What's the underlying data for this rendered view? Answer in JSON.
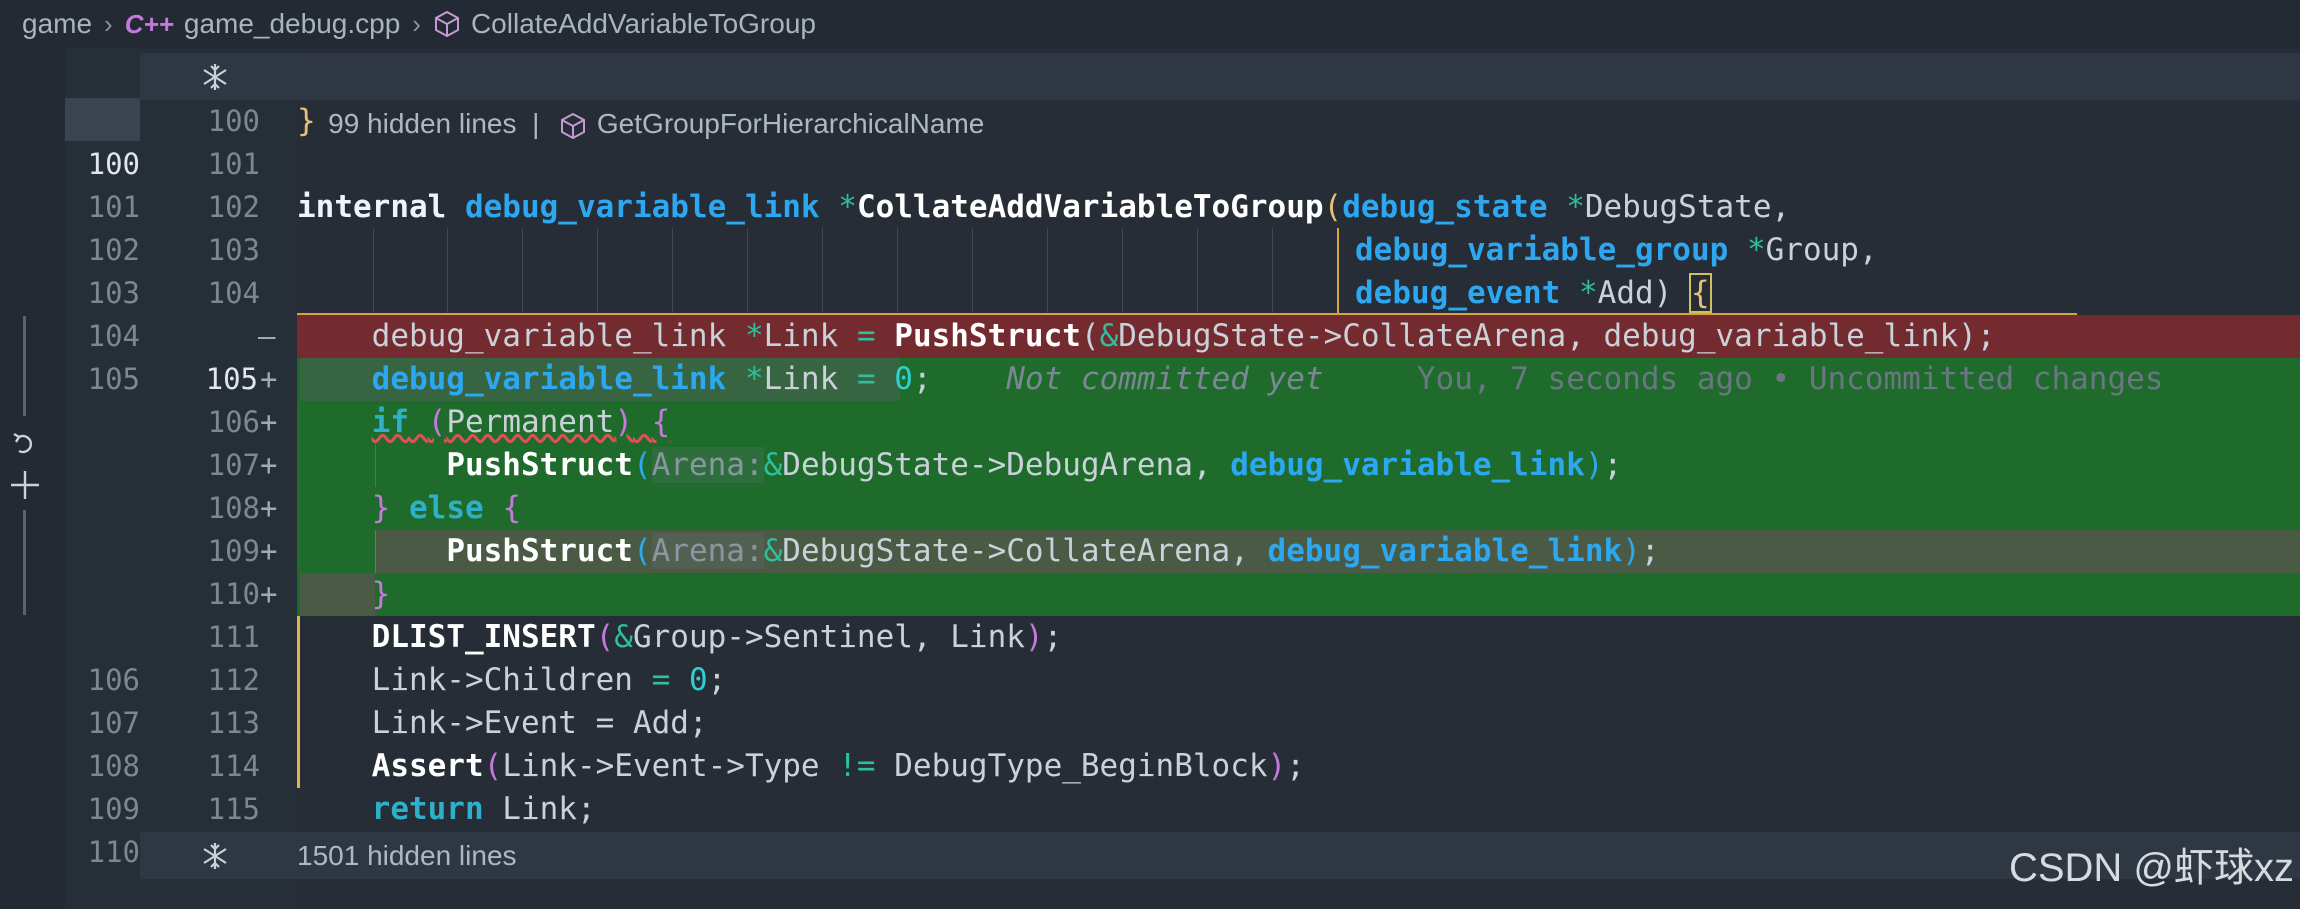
{
  "breadcrumb": {
    "folder": "game",
    "file": "game_debug.cpp",
    "lang_badge": "C++",
    "symbol": "CollateAddVariableToGroup"
  },
  "fold_top": {
    "text": "99 hidden lines",
    "sep": "|",
    "symbol": "GetGroupForHierarchicalName"
  },
  "fold_bottom": {
    "text": "1501 hidden lines"
  },
  "line_numbers": {
    "old": [
      "",
      "100",
      "101",
      "102",
      "103",
      "104",
      "105",
      "",
      "",
      "",
      "",
      "",
      "",
      "106",
      "107",
      "108",
      "109",
      "110"
    ],
    "new": [
      "100",
      "101",
      "102",
      "103",
      "104",
      "",
      "105",
      "106",
      "107",
      "108",
      "109",
      "110",
      "111",
      "112",
      "113",
      "114",
      "115",
      ""
    ]
  },
  "diff_marks": {
    "deleted": "—",
    "added": "+"
  },
  "code": {
    "l100": "}",
    "sig_internal": "internal",
    "sig_type": "debug_variable_link",
    "sig_star": "*",
    "sig_fn": "CollateAddVariableToGroup",
    "sig_p1_type": "debug_state",
    "sig_p1_name": "DebugState,",
    "sig_p2_type": "debug_variable_group",
    "sig_p2_name": "Group,",
    "sig_p3_type": "debug_event",
    "sig_p3_name": "Add)",
    "open_brace": "{",
    "del_line_a": "    debug_variable_link ",
    "del_line_b": "*",
    "del_line_c": "Link ",
    "del_line_d": "=",
    "del_line_fn": "PushStruct",
    "del_line_e": "(",
    "del_line_amp": "&",
    "del_line_f": "DebugState->CollateArena, debug_variable_link);",
    "add1_type": "debug_variable_link",
    "add1_rest": "Link ",
    "add1_num": "0",
    "add1_semi": ";",
    "ghost": "Not committed yet",
    "blame": "You, 7 seconds ago • Uncommitted changes",
    "if_kw": "if",
    "if_cond": "Permanent",
    "push_fn": "PushStruct",
    "hint_arena": "Arena:",
    "debug_arena": "DebugState->DebugArena, ",
    "collate_arena": "DebugState->CollateArena, ",
    "dvl": "debug_variable_link",
    "close_paren_semi": ");",
    "else_kw": "else",
    "close_brace": "}",
    "dlist_fn": "DLIST_INSERT",
    "dlist_args": "Group->Sentinel, Link",
    "children": "Link->Children ",
    "event": "Link->Event = Add;",
    "assert_fn": "Assert",
    "assert_args": "Link->Event->Type ",
    "neq": "!=",
    "assert_tail": " DebugType_BeginBlock",
    "return_kw": "return",
    "return_val": " Link;"
  },
  "watermark": "CSDN @虾球xz",
  "colors": {
    "deleted_bg": "#742b30",
    "added_bg": "#1e6b2c",
    "type": "#2da7f0",
    "accent_yellow": "#d9b54a"
  }
}
